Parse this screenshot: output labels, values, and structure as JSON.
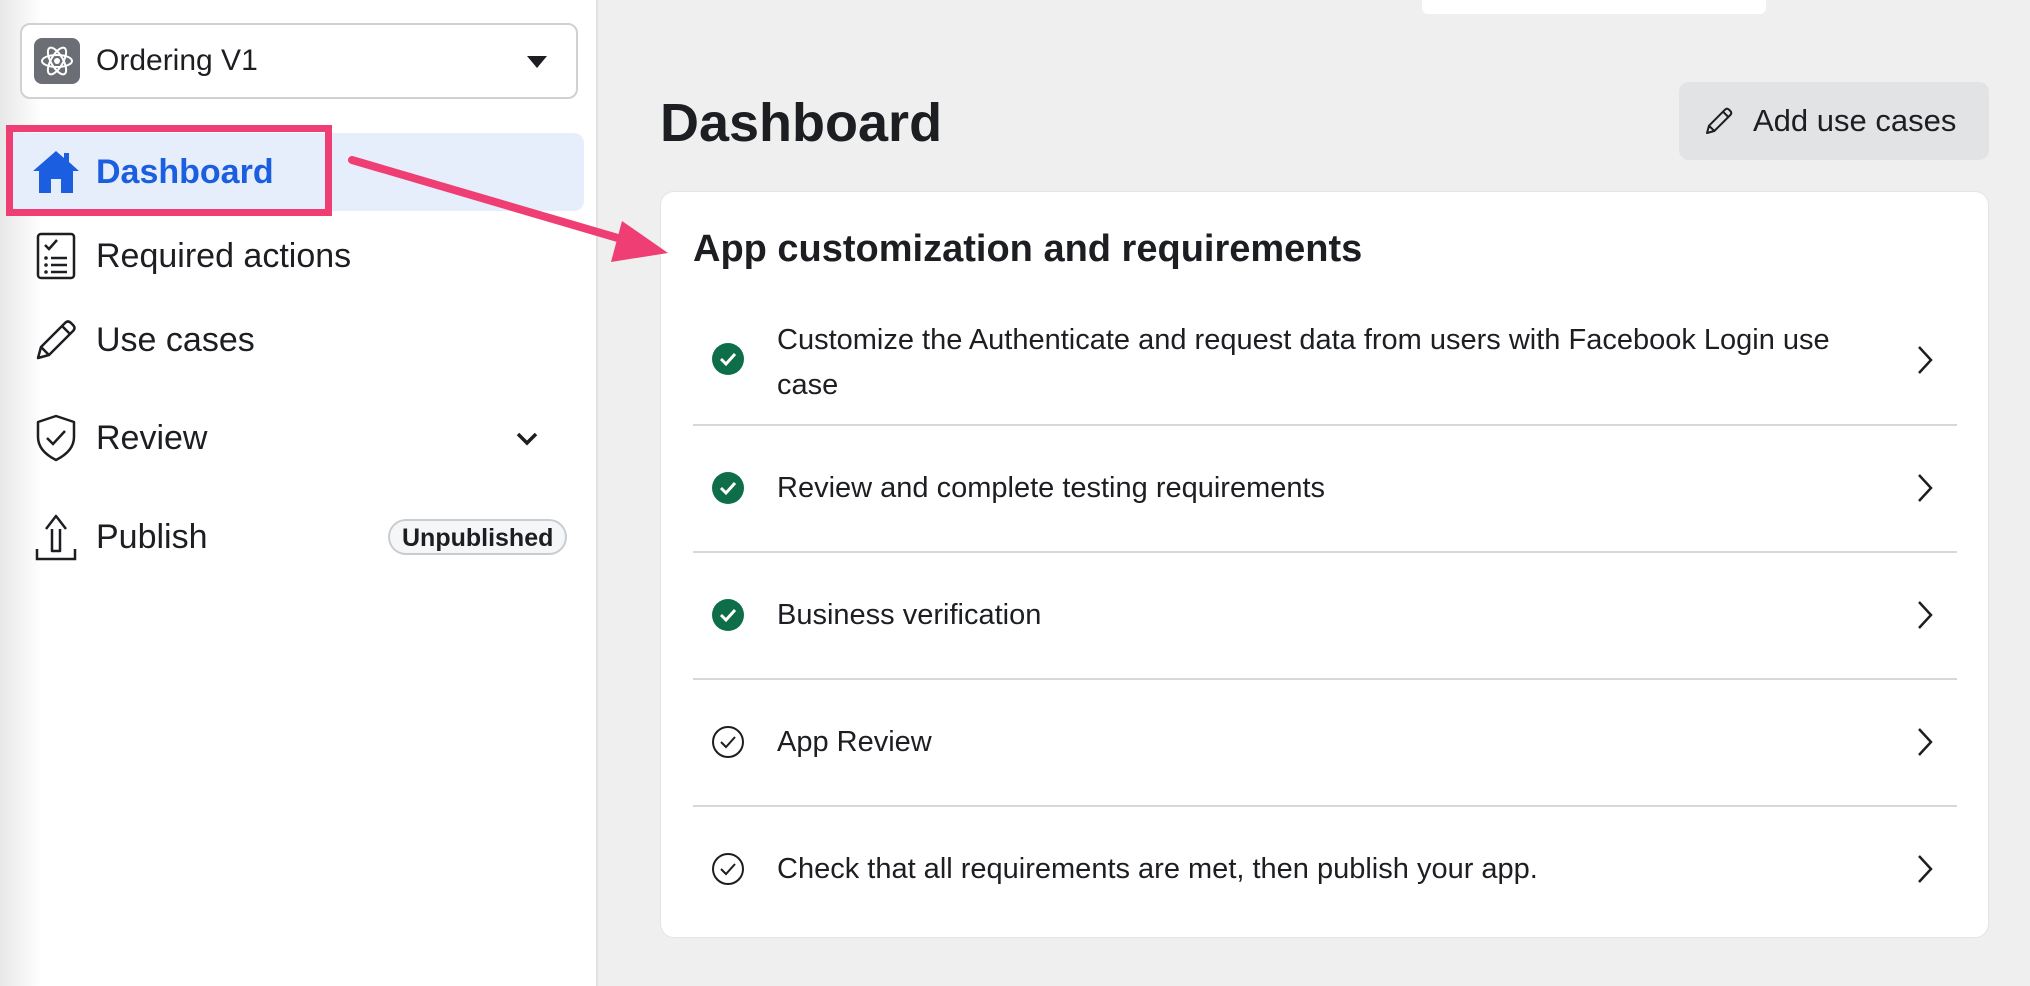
{
  "sidebar": {
    "app_selector": {
      "name": "Ordering V1",
      "icon": "atom-icon",
      "caret": "caret-down-icon"
    },
    "items": [
      {
        "label": "Dashboard",
        "icon": "home-icon",
        "active": true
      },
      {
        "label": "Required actions",
        "icon": "checklist-icon"
      },
      {
        "label": "Use cases",
        "icon": "pencil-icon"
      },
      {
        "label": "Review",
        "icon": "shield-check-icon",
        "expand_icon": "chevron-down-icon"
      },
      {
        "label": "Publish",
        "icon": "upload-icon",
        "badge": "Unpublished"
      }
    ]
  },
  "main": {
    "title": "Dashboard",
    "add_button": {
      "label": "Add use cases",
      "icon": "pencil-icon"
    },
    "card": {
      "title": "App customization and requirements",
      "rows": [
        {
          "label": "Customize the Authenticate and request data from users with Facebook Login use case",
          "status": "complete"
        },
        {
          "label": "Review and complete testing requirements",
          "status": "complete"
        },
        {
          "label": "Business verification",
          "status": "complete"
        },
        {
          "label": "App Review",
          "status": "pending"
        },
        {
          "label": "Check that all requirements are met, then publish your app.",
          "status": "pending"
        }
      ]
    }
  },
  "colors": {
    "active_nav_text": "#1b5fe0",
    "active_nav_bg": "#e7eefb",
    "annotation": "#ef3e73",
    "check_complete": "#0f6e4a"
  }
}
